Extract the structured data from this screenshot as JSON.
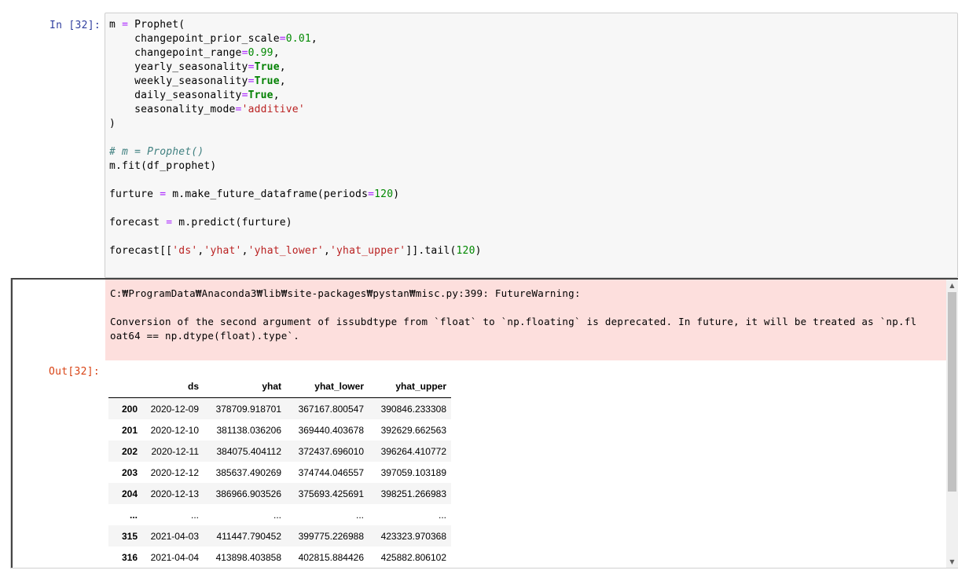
{
  "cell": {
    "in_prompt": "In [32]:",
    "out_prompt": "Out[32]:",
    "code_lines": {
      "l1a": "m ",
      "l1b": "=",
      "l1c": " Prophet(",
      "l2a": "    changepoint_prior_scale",
      "l2b": "=",
      "l2c": "0.01",
      "l2d": ",",
      "l3a": "    changepoint_range",
      "l3b": "=",
      "l3c": "0.99",
      "l3d": ",",
      "l4a": "    yearly_seasonality",
      "l4b": "=",
      "l4c": "True",
      "l4d": ",",
      "l5a": "    weekly_seasonality",
      "l5b": "=",
      "l5c": "True",
      "l5d": ",",
      "l6a": "    daily_seasonality",
      "l6b": "=",
      "l6c": "True",
      "l6d": ",",
      "l7a": "    seasonality_mode",
      "l7b": "=",
      "l7c": "'additive'",
      "l8": ")",
      "l10": "# m = Prophet()",
      "l11": "m.fit(df_prophet)",
      "l13a": "furture ",
      "l13b": "=",
      "l13c": " m.make_future_dataframe(periods",
      "l13d": "=",
      "l13e": "120",
      "l13f": ")",
      "l15a": "forecast ",
      "l15b": "=",
      "l15c": " m.predict(furture)",
      "l17a": "forecast[[",
      "l17b": "'ds'",
      "l17c": ",",
      "l17d": "'yhat'",
      "l17e": ",",
      "l17f": "'yhat_lower'",
      "l17g": ",",
      "l17h": "'yhat_upper'",
      "l17i": "]].tail(",
      "l17j": "120",
      "l17k": ")"
    },
    "stderr_text": "C:₩ProgramData₩Anaconda3₩lib₩site-packages₩pystan₩misc.py:399: FutureWarning:\n\nConversion of the second argument of issubdtype from `float` to `np.floating` is deprecated. In future, it will be treated as `np.fl\noat64 == np.dtype(float).type`."
  },
  "table": {
    "headers": [
      "",
      "ds",
      "yhat",
      "yhat_lower",
      "yhat_upper"
    ],
    "rows": [
      [
        "200",
        "2020-12-09",
        "378709.918701",
        "367167.800547",
        "390846.233308"
      ],
      [
        "201",
        "2020-12-10",
        "381138.036206",
        "369440.403678",
        "392629.662563"
      ],
      [
        "202",
        "2020-12-11",
        "384075.404112",
        "372437.696010",
        "396264.410772"
      ],
      [
        "203",
        "2020-12-12",
        "385637.490269",
        "374744.046557",
        "397059.103189"
      ],
      [
        "204",
        "2020-12-13",
        "386966.903526",
        "375693.425691",
        "398251.266983"
      ],
      [
        "...",
        "...",
        "...",
        "...",
        "..."
      ],
      [
        "315",
        "2021-04-03",
        "411447.790452",
        "399775.226988",
        "423323.970368"
      ],
      [
        "316",
        "2021-04-04",
        "413898.403858",
        "402815.884426",
        "425882.806102"
      ]
    ]
  },
  "scrollbar": {
    "up_icon": "triangle-up",
    "down_icon": "triangle-down"
  }
}
